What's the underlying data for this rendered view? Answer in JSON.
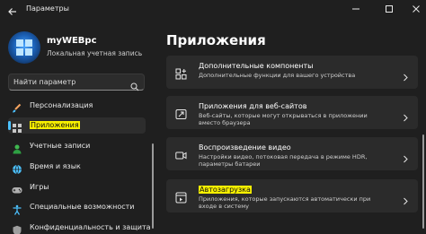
{
  "window": {
    "title": "Параметры",
    "controls": [
      "minimize",
      "maximize",
      "close"
    ]
  },
  "profile": {
    "name": "myWEBpc",
    "account_type": "Локальная учетная запись"
  },
  "search": {
    "placeholder": "Найти параметр"
  },
  "sidebar": {
    "items": [
      {
        "label": "Персонализация",
        "icon": "brush-icon",
        "active": false
      },
      {
        "label": "Приложения",
        "icon": "apps-icon",
        "active": true
      },
      {
        "label": "Учетные записи",
        "icon": "person-icon",
        "active": false
      },
      {
        "label": "Время и язык",
        "icon": "globe-clock-icon",
        "active": false
      },
      {
        "label": "Игры",
        "icon": "gamepad-icon",
        "active": false
      },
      {
        "label": "Специальные возможности",
        "icon": "accessibility-icon",
        "active": false
      },
      {
        "label": "Конфиденциальность и защита",
        "icon": "shield-icon",
        "active": false
      }
    ]
  },
  "main": {
    "title": "Приложения",
    "cards": [
      {
        "title": "Дополнительные компоненты",
        "desc": "Дополнительные функции для вашего устройства",
        "icon": "optional-features-icon"
      },
      {
        "title": "Приложения для веб-сайтов",
        "desc": "Веб-сайты, которые могут открываться в приложении вместо браузера",
        "icon": "web-apps-icon"
      },
      {
        "title": "Воспроизведение видео",
        "desc": "Настройки видео, потоковая передача в режиме HDR, параметры батареи",
        "icon": "video-icon"
      },
      {
        "title": "Автозагрузка",
        "desc": "Приложения, которые запускаются автоматически при входе в систему",
        "icon": "startup-icon"
      }
    ]
  },
  "colors": {
    "background": "#1f1f1f",
    "card": "#2b2b2b",
    "accent": "#4cc2ff",
    "highlight": "#f8f000"
  }
}
